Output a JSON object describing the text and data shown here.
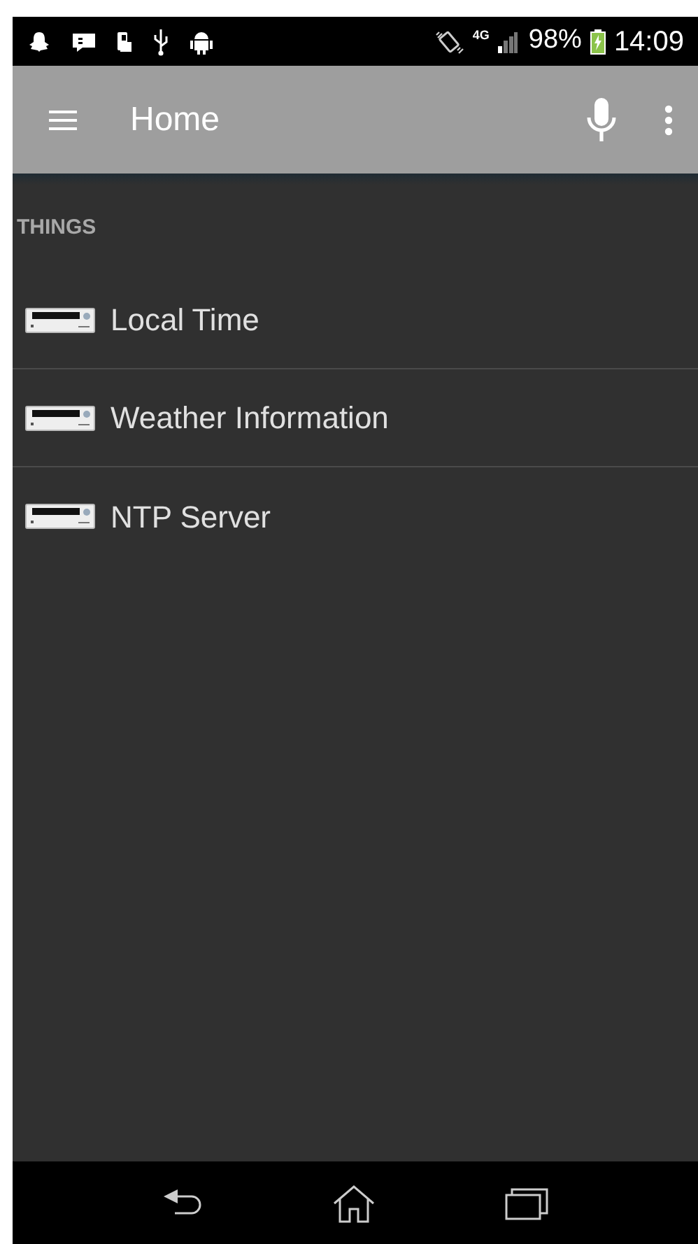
{
  "status_bar": {
    "network": "4G",
    "battery": "98%",
    "time": "14:09"
  },
  "app_bar": {
    "title": "Home"
  },
  "section": {
    "title": "THINGS"
  },
  "items": [
    {
      "label": "Local Time"
    },
    {
      "label": "Weather Information"
    },
    {
      "label": "NTP Server"
    }
  ]
}
